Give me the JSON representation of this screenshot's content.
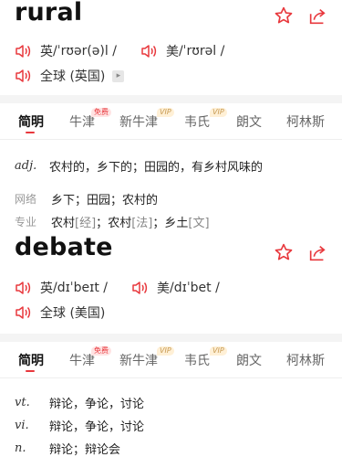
{
  "colors": {
    "accent": "#e8383d",
    "vip": "#c79a52",
    "separator": "#f4f4f4",
    "text": "#222222",
    "muted": "#999999"
  },
  "icons": {
    "speaker": "speaker-icon",
    "star": "star-icon",
    "share": "share-icon",
    "arrow": "chevron-right-icon"
  },
  "entries": [
    {
      "word": "rural",
      "uk": {
        "label": "英",
        "ipa": "/ ˈrʊər(ə)l /"
      },
      "us": {
        "label": "美",
        "ipa": "/ ˈrʊrəl /"
      },
      "global": "全球 (英国)",
      "tabs": [
        "简明",
        "牛津",
        "新牛津",
        "韦氏",
        "朗文",
        "柯林斯"
      ],
      "badges": {
        "free": "免费",
        "vip": "VIP"
      },
      "definitions": [
        {
          "pos": "adj.",
          "text": "农村的，乡下的；田园的，有乡村风味的"
        }
      ],
      "web": {
        "label": "网络",
        "text": "乡下；田园；农村的"
      },
      "specialty": {
        "label": "专业",
        "items": [
          {
            "term": "农村",
            "src": "[经]"
          },
          {
            "term": "农村",
            "src": "[法]"
          },
          {
            "term": "乡土",
            "src": "[文]"
          }
        ]
      }
    },
    {
      "word": "debate",
      "uk": {
        "label": "英",
        "ipa": "/ dɪˈbeɪt /"
      },
      "us": {
        "label": "美",
        "ipa": "/ dɪˈbet /"
      },
      "global": "全球 (美国)",
      "tabs": [
        "简明",
        "牛津",
        "新牛津",
        "韦氏",
        "朗文",
        "柯林斯"
      ],
      "badges": {
        "free": "免费",
        "vip": "VIP"
      },
      "definitions": [
        {
          "pos": "vt.",
          "text": "辩论，争论，讨论"
        },
        {
          "pos": "vi.",
          "text": "辩论，争论，讨论"
        },
        {
          "pos": "n.",
          "text": "辩论；辩论会"
        }
      ]
    }
  ]
}
